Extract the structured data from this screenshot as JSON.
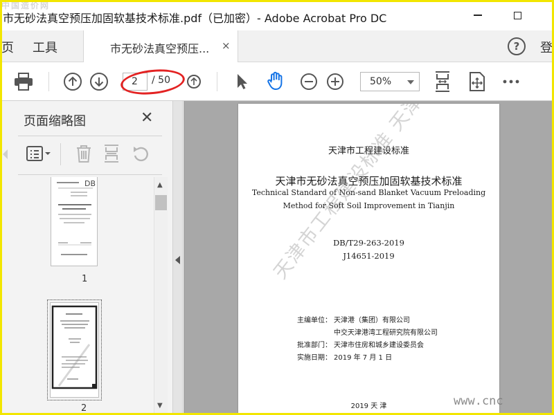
{
  "window": {
    "title": "市无砂法真空预压加固软基技术标准.pdf（已加密）- Adobe Acrobat Pro DC",
    "watermark_top": "中国造价网"
  },
  "tabs": {
    "home": "页",
    "tools": "工具",
    "document_tab": "市无砂法真空预压...",
    "close_glyph": "×",
    "sign_in": "登"
  },
  "toolbar": {
    "current_page": "2",
    "page_total": "/ 50",
    "zoom": "50%",
    "icons": [
      "print-icon",
      "page-up-icon",
      "page-down-icon",
      "zoom-search-icon",
      "select-arrow-icon",
      "hand-tool-icon",
      "zoom-out-icon",
      "zoom-in-icon",
      "fit-page-icon",
      "scroll-mode-icon",
      "more-icon"
    ],
    "accent_color": "#1473e6",
    "highlight_color": "#e32222"
  },
  "thumbnails_panel": {
    "title": "页面缩略图",
    "close_glyph": "✕",
    "pages": [
      {
        "number": "1"
      },
      {
        "number": "2"
      }
    ]
  },
  "document": {
    "header": "天津市工程建设标准",
    "title_cn": "天津市无砂法真空预压加固软基技术标准",
    "title_en_1": "Technical Standard of Non-sand Blanket Vacuum Preloading",
    "title_en_2": "Method for Soft Soil Improvement in Tianjin",
    "code1": "DB/T29-263-2019",
    "code2": "J14651-2019",
    "editor_label": "主编单位：",
    "editor_1": "天津港（集团）有限公司",
    "editor_2": "中交天津港湾工程研究院有限公司",
    "approver_label": "批准部门：",
    "approver": "天津市住房和城乡建设委员会",
    "date_label": "实施日期：",
    "date": "2019 年 7 月 1 日",
    "footer": "2019 天  津",
    "watermark": "天津市工程建设标准 天津住建网全文公开",
    "corner_watermark": "www.cnc"
  }
}
